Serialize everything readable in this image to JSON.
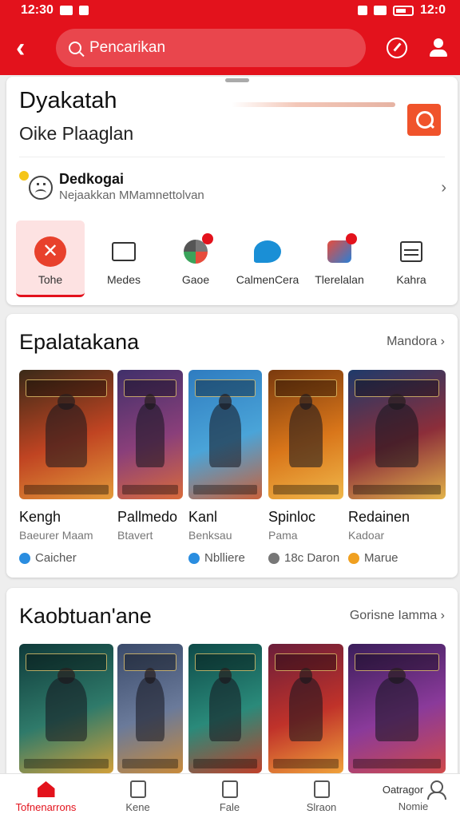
{
  "status_bar": {
    "time": "12:30",
    "right_time": "12:0"
  },
  "header": {
    "search_placeholder": "Pencarikan"
  },
  "featured": {
    "title": "Dyakatah",
    "subtitle": "Oike Plaaglan"
  },
  "account": {
    "name": "Dedkogai",
    "description": "Nejaakkan MMamnettolvan"
  },
  "quick_actions": [
    {
      "label": "Tohe",
      "icon": "close-circle-icon"
    },
    {
      "label": "Medes",
      "icon": "screen-icon"
    },
    {
      "label": "Gaoe",
      "icon": "game-icon"
    },
    {
      "label": "CalmenCera",
      "icon": "chat-icon"
    },
    {
      "label": "Tlerelalan",
      "icon": "event-icon"
    },
    {
      "label": "Kahra",
      "icon": "list-icon"
    }
  ],
  "section1": {
    "title": "Epalatakana",
    "more": "Mandora",
    "games": [
      {
        "name": "Kengh",
        "sub": "Baeurer Maam",
        "tag": "Caicher",
        "colors": [
          "#3a2a18",
          "#c04422",
          "#e39a3a"
        ]
      },
      {
        "name": "Pallmedo",
        "sub": "Btavert",
        "tag": "",
        "colors": [
          "#40306a",
          "#8a3f7a",
          "#d96b3b"
        ]
      },
      {
        "name": "Kanl",
        "sub": "Benksau",
        "tag": "Nblliere",
        "colors": [
          "#2f7cc0",
          "#4aa4d8",
          "#c9613a"
        ]
      },
      {
        "name": "Spinloc",
        "sub": "Pama",
        "tag": "18c Daron",
        "colors": [
          "#7a3a0e",
          "#d9761a",
          "#f0b74a"
        ]
      },
      {
        "name": "Redainen",
        "sub": "Kadoar",
        "tag": "Marue",
        "colors": [
          "#1e3a6a",
          "#8c2e3a",
          "#e2b34a"
        ]
      }
    ]
  },
  "section2": {
    "title": "Kaobtuan'ane",
    "more": "Gorisne Iamma",
    "games": [
      {
        "colors": [
          "#0f3a3a",
          "#2f7a6a",
          "#d1a03a"
        ]
      },
      {
        "colors": [
          "#3a4a6a",
          "#6a7a9a",
          "#c88a3a"
        ]
      },
      {
        "colors": [
          "#0e4a48",
          "#2a8a7a",
          "#c0402a"
        ]
      },
      {
        "colors": [
          "#6a1e3a",
          "#c0322a",
          "#f0a23a"
        ]
      },
      {
        "colors": [
          "#3a1e5a",
          "#8a3a9a",
          "#d04a4a"
        ]
      }
    ]
  },
  "bottom_nav": {
    "extra_label": "Oatragor",
    "items": [
      {
        "label": "Tofnenarrons",
        "icon": "home-icon"
      },
      {
        "label": "Kene",
        "icon": "book-icon"
      },
      {
        "label": "Fale",
        "icon": "file-icon"
      },
      {
        "label": "Slraon",
        "icon": "library-icon"
      },
      {
        "label": "Nomie",
        "icon": "user-icon"
      }
    ]
  }
}
